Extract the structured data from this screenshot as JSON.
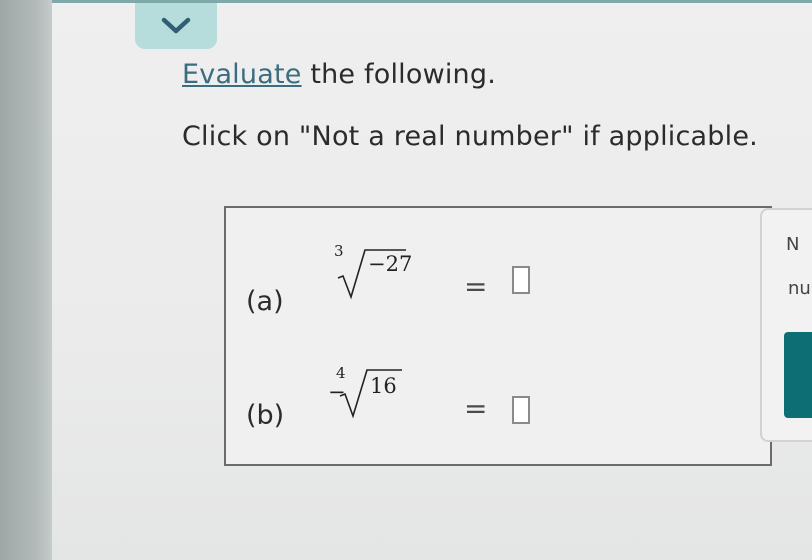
{
  "header": {
    "collapse_icon": "chevron-down-icon"
  },
  "prompt": {
    "link_word": "Evaluate",
    "rest_of_title": " the following.",
    "instruction": "Click on \"Not a real number\" if applicable."
  },
  "problems": [
    {
      "label": "(a)",
      "index": "3",
      "sign": "",
      "radicand": "−27",
      "equals": "=",
      "answer": ""
    },
    {
      "label": "(b)",
      "index": "4",
      "sign": "−",
      "radicand": "16",
      "equals": "=",
      "answer": ""
    }
  ],
  "side_panel": {
    "top_text": "N",
    "text": "nu"
  },
  "colors": {
    "accent": "#3a6d7f",
    "tab": "#b6dcdc",
    "button": "#0d6f73"
  }
}
